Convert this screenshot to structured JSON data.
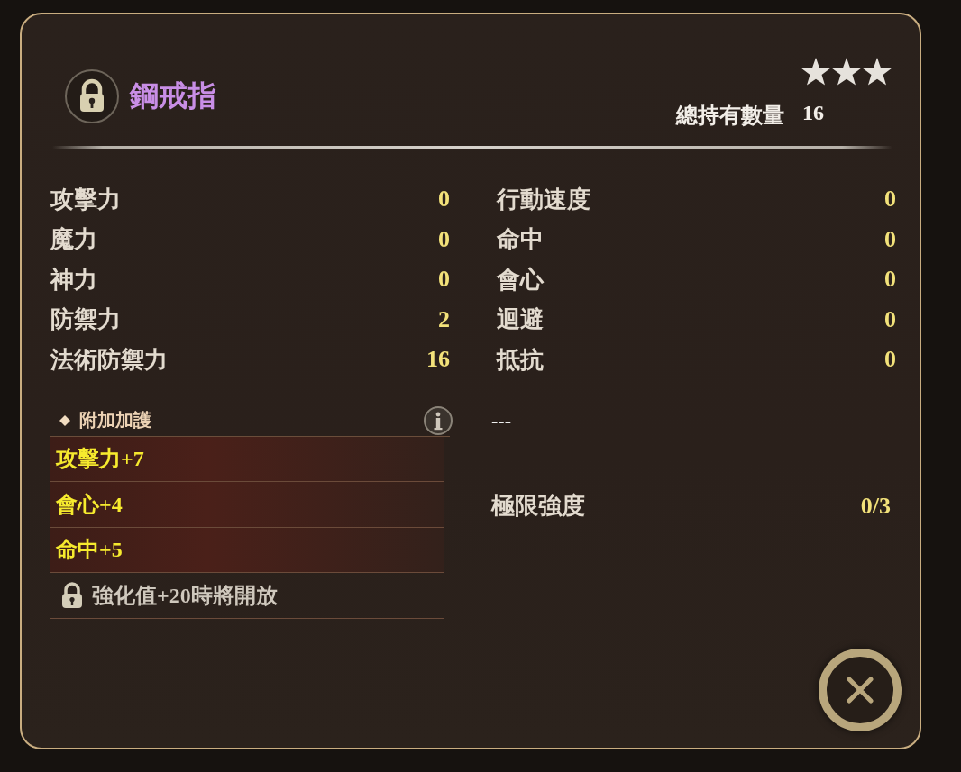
{
  "item": {
    "name": "鋼戒指",
    "locked": true,
    "stars": 3
  },
  "total_owned": {
    "label": "總持有數量",
    "value": "16"
  },
  "stats_left": [
    {
      "label": "攻擊力",
      "value": "0"
    },
    {
      "label": "魔力",
      "value": "0"
    },
    {
      "label": "神力",
      "value": "0"
    },
    {
      "label": "防禦力",
      "value": "2"
    },
    {
      "label": "法術防禦力",
      "value": "16"
    }
  ],
  "stats_right": [
    {
      "label": "行動速度",
      "value": "0"
    },
    {
      "label": "命中",
      "value": "0"
    },
    {
      "label": "會心",
      "value": "0"
    },
    {
      "label": "迴避",
      "value": "0"
    },
    {
      "label": "抵抗",
      "value": "0"
    }
  ],
  "bonus": {
    "title": "附加加護",
    "effects": [
      {
        "text": "攻擊力+7",
        "kind": "active"
      },
      {
        "text": "會心+4",
        "kind": "active"
      },
      {
        "text": "命中+5",
        "kind": "active"
      },
      {
        "text": "強化值+20時將開放",
        "kind": "locked"
      }
    ]
  },
  "bonus_right": {
    "text": "---"
  },
  "limit_strength": {
    "label": "極限強度",
    "value": "0/3"
  }
}
